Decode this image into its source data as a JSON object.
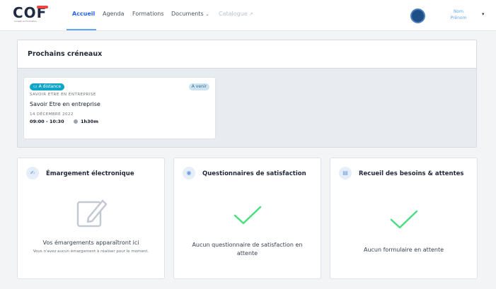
{
  "header": {
    "logo_text": "COF",
    "logo_sub": "Conseil en Formation",
    "nav": [
      {
        "label": "Accueil",
        "active": true
      },
      {
        "label": "Agenda"
      },
      {
        "label": "Formations"
      },
      {
        "label": "Documents",
        "dropdown": true
      },
      {
        "label": "Catalogue",
        "external": true,
        "disabled": true
      }
    ],
    "user": {
      "first": "Nom",
      "last": "Prénom"
    }
  },
  "slots": {
    "title": "Prochains créneaux",
    "items": [
      {
        "mode": "A distance",
        "status": "A venir",
        "category": "SAVOIR ETRE EN ENTREPRISE",
        "name": "Savoir Etre en entreprise",
        "date": "14 DÉCEMBRE 2022",
        "time": "09:00 - 10:30",
        "duration": "1h30m"
      }
    ]
  },
  "cards": {
    "signature": {
      "icon": "signature-icon",
      "title": "Émargement électronique",
      "message": "Vos émargements apparaîtront ici",
      "sub": "Vous n'avez aucun émargement à réaliser pour le moment."
    },
    "survey": {
      "icon": "lightbulb-icon",
      "title": "Questionnaires de satisfaction",
      "message": "Aucun questionnaire de satisfaction en attente"
    },
    "needs": {
      "icon": "form-icon",
      "title": "Recueil des besoins & attentes",
      "message": "Aucun formulaire en attente"
    }
  },
  "colors": {
    "accent": "#2563eb",
    "success": "#4ade80",
    "badge": "#0ea5c6"
  }
}
